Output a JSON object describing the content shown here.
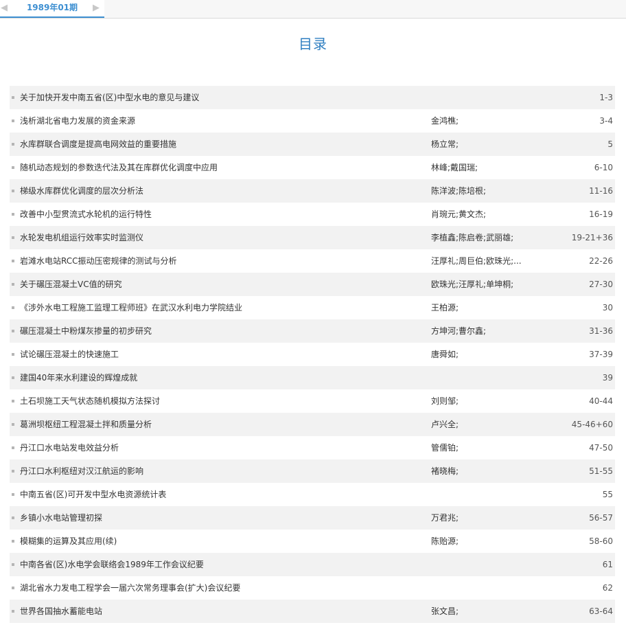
{
  "tab": {
    "label": "1989年01期"
  },
  "page": {
    "title": "目录"
  },
  "articles": [
    {
      "title": "关于加快开发中南五省(区)中型水电的意见与建议",
      "author": "",
      "pages": "1-3"
    },
    {
      "title": "浅析湖北省电力发展的资金来源",
      "author": "金鸿樵;",
      "pages": "3-4"
    },
    {
      "title": "水库群联合调度是提高电网效益的重要措施",
      "author": "杨立常;",
      "pages": "5"
    },
    {
      "title": "随机动态规划的参数迭代法及其在库群优化调度中应用",
      "author": "林峰;戴国瑞;",
      "pages": "6-10"
    },
    {
      "title": "梯级水库群优化调度的层次分析法",
      "author": "陈洋波;陈培根;",
      "pages": "11-16"
    },
    {
      "title": "改善中小型贯流式水轮机的运行特性",
      "author": "肖琬元;黄文杰;",
      "pages": "16-19"
    },
    {
      "title": "水轮发电机组运行效率实时监测仪",
      "author": "李植鑫;陈启卷;武丽雄;",
      "pages": "19-21+36"
    },
    {
      "title": "岩滩水电站RCC振动压密规律的测试与分析",
      "author": "汪厚礼;周巨伯;欧珠光;...",
      "pages": "22-26"
    },
    {
      "title": "关于碾压混凝土VC值的研究",
      "author": "欧珠光;汪厚礼;单坤桐;",
      "pages": "27-30"
    },
    {
      "title": "《涉外水电工程施工监理工程师班》在武汉水利电力学院结业",
      "author": "王柏源;",
      "pages": "30"
    },
    {
      "title": "碾压混凝土中粉煤灰掺量的初步研究",
      "author": "方坤河;曹尔鑫;",
      "pages": "31-36"
    },
    {
      "title": "试论碾压混凝土的快速施工",
      "author": "唐舜如;",
      "pages": "37-39"
    },
    {
      "title": "建国40年来水利建设的辉煌成就",
      "author": "",
      "pages": "39"
    },
    {
      "title": "土石坝施工天气状态随机模拟方法探讨",
      "author": "刘则邹;",
      "pages": "40-44"
    },
    {
      "title": "葛洲坝枢纽工程混凝土拌和质量分析",
      "author": "卢兴全;",
      "pages": "45-46+60"
    },
    {
      "title": "丹江口水电站发电效益分析",
      "author": "管儒铂;",
      "pages": "47-50"
    },
    {
      "title": "丹江口水利枢纽对汉江航运的影响",
      "author": "褚晓梅;",
      "pages": "51-55"
    },
    {
      "title": "中南五省(区)可开发中型水电资源统计表",
      "author": "",
      "pages": "55"
    },
    {
      "title": "乡镇小水电站管理初探",
      "author": "万君兆;",
      "pages": "56-57"
    },
    {
      "title": "模糊集的运算及其应用(续)",
      "author": "陈贻源;",
      "pages": "58-60"
    },
    {
      "title": "中南各省(区)水电学会联络会1989年工作会议纪要",
      "author": "",
      "pages": "61"
    },
    {
      "title": "湖北省水力发电工程学会一届六次常务理事会(扩大)会议纪要",
      "author": "",
      "pages": "62"
    },
    {
      "title": "世界各国抽水蓄能电站",
      "author": "张文昌;",
      "pages": "63-64"
    }
  ],
  "colors": {
    "accent": "#3d8fd1",
    "title": "#2f7fc1",
    "row_alt": "#f2f2f2"
  },
  "icons": {
    "prev": "chevron-left-icon",
    "next": "chevron-right-icon"
  }
}
